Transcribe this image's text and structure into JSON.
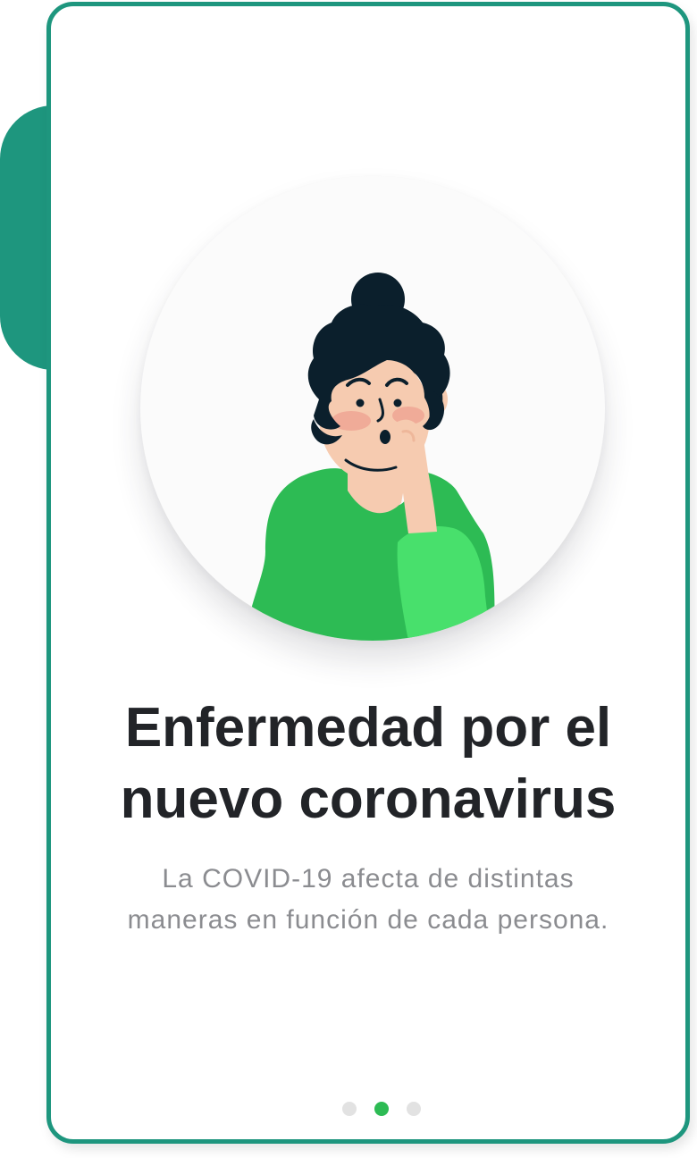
{
  "onboarding": {
    "title_line1": "Enfermedad por el",
    "title_line2": "nuevo coronavirus",
    "description_line1": "La COVID-19 afecta de distintas",
    "description_line2": "maneras en función de cada persona."
  },
  "illustration": {
    "icon": "sick-woman-coughing-illustration"
  },
  "pagination": {
    "total": 3,
    "active_index": 1
  },
  "colors": {
    "accent": "#1e967e",
    "active_dot": "#2dbb54",
    "inactive_dot": "#e2e2e2",
    "title": "#222428",
    "description": "#8b8c90"
  }
}
